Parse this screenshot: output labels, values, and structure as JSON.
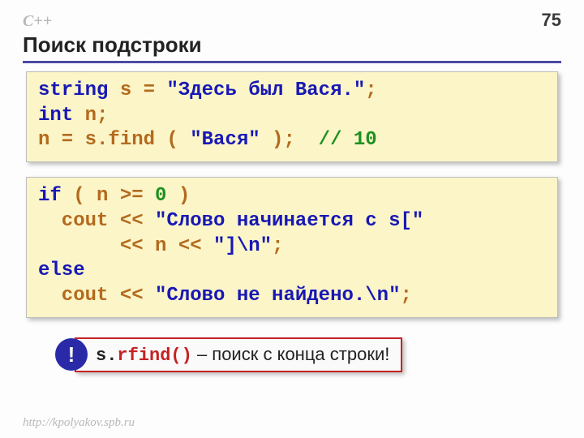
{
  "header": {
    "lang": "C++",
    "page": "75",
    "title": "Поиск подстроки"
  },
  "code1": {
    "l1": {
      "a": "string",
      "b": " s = ",
      "c": "\"Здесь был Вася.\"",
      "d": ";"
    },
    "l2": {
      "a": "int",
      "b": " n;"
    },
    "l3": {
      "a": "n = s.find ( ",
      "b": "\"Вася\"",
      "c": " );  ",
      "d": "// 10"
    }
  },
  "code2": {
    "l1": {
      "a": "if",
      "b": " ( n >= ",
      "c": "0",
      "d": " )"
    },
    "l2": {
      "a": "  cout << ",
      "b": "\"Слово начинается с s[\""
    },
    "l3": {
      "a": "       << n << ",
      "b": "\"]\\n\"",
      "c": ";"
    },
    "l4": {
      "a": "else"
    },
    "l5": {
      "a": "  cout << ",
      "b": "\"Слово не найдено.\\n\"",
      "c": ";"
    }
  },
  "tip": {
    "bang": "!",
    "prefix": "s.",
    "fn": "rfind()",
    "suffix": " – поиск с конца строки!"
  },
  "footer": "http://kpolyakov.spb.ru"
}
